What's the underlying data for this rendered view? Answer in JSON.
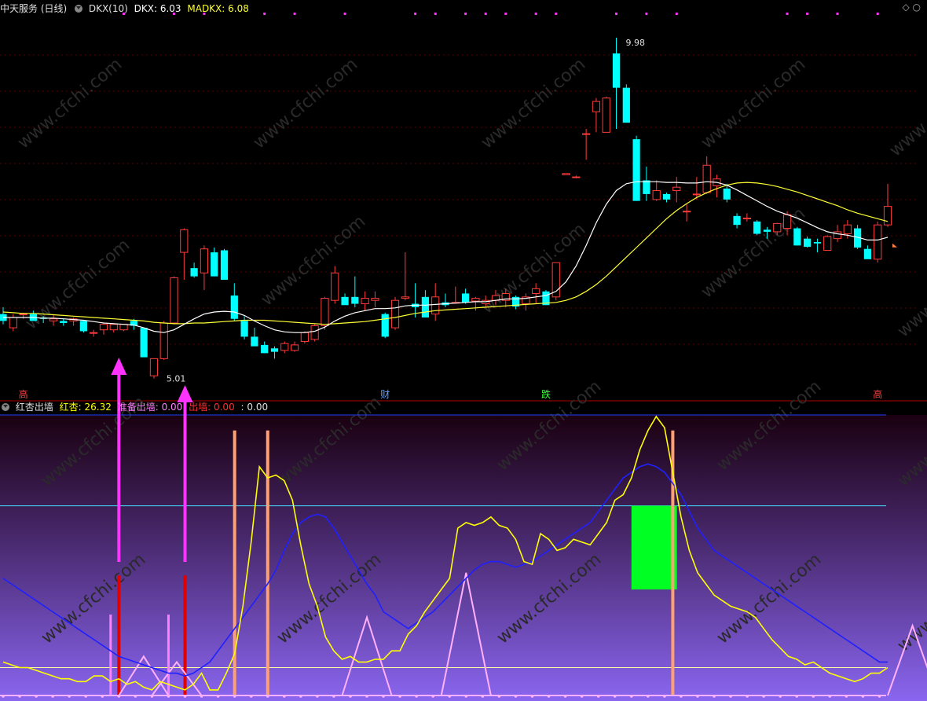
{
  "top_header": {
    "stock_name": "中天服务 (日线)",
    "indicator": "DKX(10)",
    "dkx_label": "DKX: 6.03",
    "madkx_label": "MADKX: 6.08"
  },
  "bottom_header": {
    "name": "红杏出墙",
    "hongxing_label": "红杏: 26.32",
    "zhunbei_label": "准备出墙: 0.00",
    "chuqiang_label": "出墙: 0.00",
    "extra_label": ": 0.00"
  },
  "annotations": {
    "high_label": "9.98",
    "low_label": "5.01",
    "marker_cai": "财",
    "marker_die": "跌",
    "marker_left": "高",
    "marker_right": "高"
  },
  "watermark": "www.cfchi.com",
  "colors": {
    "up": "#ff3b3b",
    "down": "#00ffff",
    "dkx": "#ffffff",
    "madkx": "#ffff33",
    "hongxing": "#ffff00",
    "blue_line": "#2020ff",
    "magenta": "#ff33ff",
    "red_bar": "#e00000",
    "orange_bar": "#ffa070",
    "pink_bar": "#ff80ff",
    "green_box": "#00ff22"
  },
  "chart_data": [
    {
      "type": "candlestick",
      "title": "中天服务 (日线)",
      "ylim": [
        4.8,
        10.3
      ],
      "candles": [
        [
          5.95,
          6.05,
          5.8,
          5.85
        ],
        [
          5.75,
          5.95,
          5.7,
          5.9
        ],
        [
          5.95,
          5.97,
          5.88,
          5.95
        ],
        [
          5.95,
          6.0,
          5.85,
          5.85
        ],
        [
          5.9,
          5.92,
          5.82,
          5.88
        ],
        [
          5.85,
          5.95,
          5.78,
          5.88
        ],
        [
          5.85,
          5.88,
          5.78,
          5.82
        ],
        [
          5.85,
          5.9,
          5.78,
          5.88
        ],
        [
          5.85,
          5.85,
          5.68,
          5.7
        ],
        [
          5.68,
          5.72,
          5.62,
          5.68
        ],
        [
          5.72,
          5.82,
          5.65,
          5.8
        ],
        [
          5.72,
          5.8,
          5.68,
          5.8
        ],
        [
          5.72,
          5.8,
          5.7,
          5.8
        ],
        [
          5.85,
          5.88,
          5.72,
          5.78
        ],
        [
          5.75,
          5.75,
          5.32,
          5.32
        ],
        [
          5.05,
          5.3,
          5.01,
          5.3
        ],
        [
          5.3,
          5.85,
          5.28,
          5.82
        ],
        [
          5.82,
          6.5,
          5.8,
          6.48
        ],
        [
          6.85,
          7.2,
          6.45,
          7.18
        ],
        [
          6.62,
          6.7,
          6.48,
          6.5
        ],
        [
          6.55,
          6.95,
          6.3,
          6.9
        ],
        [
          6.85,
          6.92,
          6.5,
          6.5
        ],
        [
          6.88,
          6.9,
          6.45,
          6.45
        ],
        [
          6.22,
          6.4,
          5.85,
          5.88
        ],
        [
          5.85,
          5.92,
          5.58,
          5.62
        ],
        [
          5.62,
          5.75,
          5.5,
          5.48
        ],
        [
          5.5,
          5.55,
          5.38,
          5.38
        ],
        [
          5.45,
          5.48,
          5.3,
          5.4
        ],
        [
          5.42,
          5.55,
          5.38,
          5.52
        ],
        [
          5.42,
          5.55,
          5.4,
          5.5
        ],
        [
          5.55,
          5.7,
          5.52,
          5.68
        ],
        [
          5.58,
          5.8,
          5.55,
          5.78
        ],
        [
          5.78,
          6.2,
          5.72,
          6.18
        ],
        [
          6.15,
          6.65,
          6.1,
          6.55
        ],
        [
          6.2,
          6.25,
          6.1,
          6.08
        ],
        [
          6.2,
          6.5,
          6.05,
          6.1
        ],
        [
          6.1,
          6.28,
          6.0,
          6.18
        ],
        [
          6.15,
          6.28,
          6.05,
          6.18
        ],
        [
          5.95,
          5.97,
          5.6,
          5.62
        ],
        [
          5.75,
          6.2,
          5.72,
          6.15
        ],
        [
          6.18,
          6.85,
          6.15,
          6.2
        ],
        [
          6.1,
          6.4,
          5.9,
          6.05
        ],
        [
          6.2,
          6.3,
          5.9,
          5.9
        ],
        [
          5.95,
          6.4,
          5.85,
          6.2
        ],
        [
          6.12,
          6.25,
          6.05,
          6.08
        ],
        [
          6.12,
          6.35,
          6.1,
          6.12
        ],
        [
          6.25,
          6.32,
          6.1,
          6.12
        ],
        [
          6.14,
          6.2,
          6.0,
          6.18
        ],
        [
          6.1,
          6.22,
          6.05,
          6.15
        ],
        [
          6.15,
          6.3,
          6.08,
          6.22
        ],
        [
          6.15,
          6.32,
          6.05,
          6.25
        ],
        [
          6.2,
          6.22,
          6.02,
          6.06
        ],
        [
          6.1,
          6.25,
          6.0,
          6.2
        ],
        [
          6.25,
          6.4,
          6.1,
          6.32
        ],
        [
          6.28,
          6.3,
          6.1,
          6.08
        ],
        [
          6.2,
          6.65,
          6.15,
          6.7
        ],
        [
          7.98,
          8.0,
          7.98,
          8.0
        ],
        [
          7.95,
          7.97,
          7.93,
          7.95
        ],
        [
          8.58,
          8.65,
          8.2,
          8.58
        ],
        [
          8.9,
          9.1,
          8.6,
          9.05
        ],
        [
          8.6,
          9.12,
          8.72,
          9.1
        ],
        [
          9.75,
          9.98,
          8.65,
          9.25
        ],
        [
          9.25,
          9.3,
          8.74,
          8.74
        ],
        [
          8.5,
          8.55,
          7.6,
          7.6
        ],
        [
          7.9,
          8.1,
          7.6,
          7.7
        ],
        [
          7.62,
          7.9,
          7.6,
          7.75
        ],
        [
          7.7,
          7.72,
          7.58,
          7.62
        ],
        [
          7.75,
          7.95,
          7.58,
          7.8
        ],
        [
          7.45,
          7.55,
          7.3,
          7.45
        ],
        [
          7.7,
          7.95,
          7.62,
          7.7
        ],
        [
          7.72,
          8.25,
          7.7,
          8.12
        ],
        [
          7.82,
          7.98,
          7.65,
          7.92
        ],
        [
          7.78,
          7.85,
          7.58,
          7.62
        ],
        [
          7.38,
          7.42,
          7.2,
          7.25
        ],
        [
          7.35,
          7.42,
          7.3,
          7.35
        ],
        [
          7.3,
          7.32,
          7.1,
          7.12
        ],
        [
          7.18,
          7.22,
          7.05,
          7.15
        ],
        [
          7.15,
          7.28,
          7.1,
          7.27
        ],
        [
          7.2,
          7.45,
          7.1,
          7.4
        ],
        [
          7.2,
          7.22,
          6.95,
          6.95
        ],
        [
          7.05,
          7.08,
          6.92,
          6.93
        ],
        [
          7.0,
          7.05,
          6.85,
          6.98
        ],
        [
          6.88,
          7.1,
          6.88,
          7.08
        ],
        [
          7.05,
          7.25,
          7.0,
          7.15
        ],
        [
          7.12,
          7.32,
          7.05,
          7.25
        ],
        [
          7.2,
          7.25,
          6.9,
          6.92
        ],
        [
          6.9,
          6.95,
          6.78,
          6.75
        ],
        [
          6.75,
          7.3,
          6.7,
          7.25
        ],
        [
          7.25,
          7.85,
          7.22,
          7.52
        ]
      ],
      "dkx": [
        5.9,
        5.9,
        5.9,
        5.9,
        5.89,
        5.89,
        5.88,
        5.87,
        5.86,
        5.84,
        5.82,
        5.81,
        5.8,
        5.79,
        5.75,
        5.7,
        5.68,
        5.72,
        5.8,
        5.88,
        5.95,
        5.98,
        5.99,
        5.98,
        5.93,
        5.85,
        5.78,
        5.72,
        5.69,
        5.68,
        5.68,
        5.7,
        5.76,
        5.85,
        5.92,
        5.97,
        6.0,
        6.03,
        6.03,
        6.04,
        6.07,
        6.08,
        6.08,
        6.09,
        6.1,
        6.11,
        6.12,
        6.13,
        6.13,
        6.15,
        6.17,
        6.17,
        6.18,
        6.2,
        6.22,
        6.28,
        6.42,
        6.65,
        6.95,
        7.28,
        7.55,
        7.75,
        7.85,
        7.88,
        7.88,
        7.88,
        7.87,
        7.87,
        7.86,
        7.86,
        7.88,
        7.87,
        7.83,
        7.76,
        7.68,
        7.6,
        7.52,
        7.45,
        7.4,
        7.35,
        7.28,
        7.21,
        7.15,
        7.12,
        7.1,
        7.07,
        7.03,
        7.03,
        7.07
      ],
      "madkx": [
        5.98,
        5.97,
        5.96,
        5.96,
        5.95,
        5.94,
        5.93,
        5.92,
        5.91,
        5.9,
        5.89,
        5.88,
        5.87,
        5.86,
        5.85,
        5.83,
        5.82,
        5.81,
        5.81,
        5.82,
        5.82,
        5.83,
        5.84,
        5.85,
        5.86,
        5.86,
        5.86,
        5.85,
        5.84,
        5.83,
        5.82,
        5.81,
        5.8,
        5.81,
        5.82,
        5.83,
        5.84,
        5.86,
        5.88,
        5.9,
        5.93,
        5.96,
        5.98,
        6.0,
        6.01,
        6.02,
        6.03,
        6.04,
        6.05,
        6.06,
        6.07,
        6.08,
        6.09,
        6.1,
        6.11,
        6.12,
        6.15,
        6.2,
        6.28,
        6.38,
        6.5,
        6.64,
        6.78,
        6.92,
        7.06,
        7.2,
        7.34,
        7.46,
        7.56,
        7.65,
        7.72,
        7.78,
        7.83,
        7.86,
        7.87,
        7.86,
        7.84,
        7.81,
        7.77,
        7.73,
        7.68,
        7.63,
        7.58,
        7.53,
        7.47,
        7.42,
        7.38,
        7.34,
        7.3
      ]
    },
    {
      "type": "line",
      "title": "红杏出墙",
      "ylim": [
        0,
        100
      ],
      "series": [
        {
          "name": "红杏",
          "values": [
            12,
            11,
            10,
            10,
            9,
            8,
            7,
            6,
            6,
            5,
            5,
            7,
            7,
            5,
            6,
            4,
            5,
            3,
            2,
            5,
            4,
            3,
            2,
            4,
            8,
            2,
            2,
            8,
            15,
            32,
            55,
            82,
            78,
            79,
            77,
            70,
            54,
            40,
            32,
            21,
            16,
            13,
            14,
            12,
            12,
            13,
            13,
            16,
            16,
            22,
            25,
            30,
            34,
            38,
            42,
            60,
            62,
            61,
            62,
            64,
            61,
            60,
            56,
            48,
            47,
            58,
            56,
            52,
            53,
            56,
            55,
            54,
            58,
            62,
            70,
            72,
            78,
            88,
            95,
            100,
            96,
            80,
            64,
            52,
            44,
            40,
            36,
            34,
            32,
            31,
            30,
            28,
            24,
            20,
            17,
            14,
            13,
            11,
            12,
            10,
            8,
            7,
            6,
            5,
            6,
            8,
            8,
            10
          ]
        },
        {
          "name": "准备出墙",
          "values": [
            42,
            40,
            38,
            36,
            34,
            32,
            30,
            28,
            26,
            24,
            22,
            20,
            18,
            16,
            14,
            13,
            12,
            11,
            10,
            9,
            8,
            8,
            7,
            8,
            10,
            12,
            16,
            20,
            24,
            28,
            32,
            36,
            40,
            45,
            52,
            58,
            62,
            64,
            65,
            64,
            60,
            55,
            50,
            45,
            40,
            36,
            30,
            28,
            26,
            24,
            26,
            28,
            30,
            33,
            36,
            39,
            42,
            45,
            47,
            48,
            48,
            47,
            46,
            47,
            48,
            50,
            52,
            54,
            56,
            58,
            60,
            62,
            66,
            70,
            74,
            78,
            80,
            82,
            83,
            82,
            80,
            76,
            72,
            66,
            60,
            56,
            52,
            50,
            48,
            46,
            44,
            42,
            40,
            38,
            36,
            34,
            32,
            30,
            28,
            26,
            24,
            22,
            20,
            18,
            16,
            14,
            12,
            12
          ]
        }
      ]
    }
  ]
}
